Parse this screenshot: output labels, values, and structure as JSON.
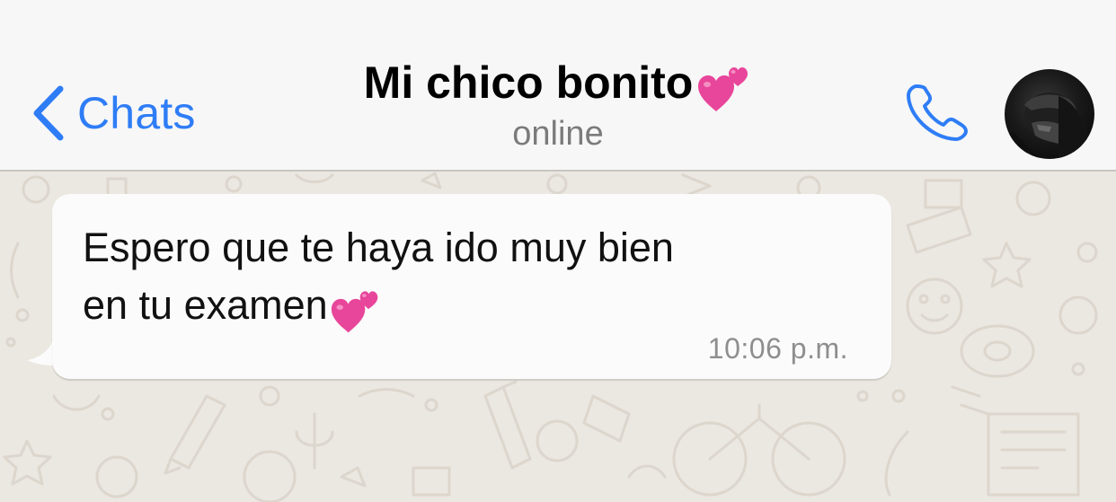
{
  "header": {
    "back_label": "Chats",
    "title": "Mi chico bonito",
    "title_emoji": "heart-pair",
    "status": "online",
    "call_icon": "phone-icon",
    "accent_color": "#2f7df6"
  },
  "messages": [
    {
      "direction": "incoming",
      "line1": "Espero que te haya ido muy bien",
      "line2": "en tu examen",
      "emoji": "heart-pair",
      "time": "10:06 p.m."
    }
  ]
}
